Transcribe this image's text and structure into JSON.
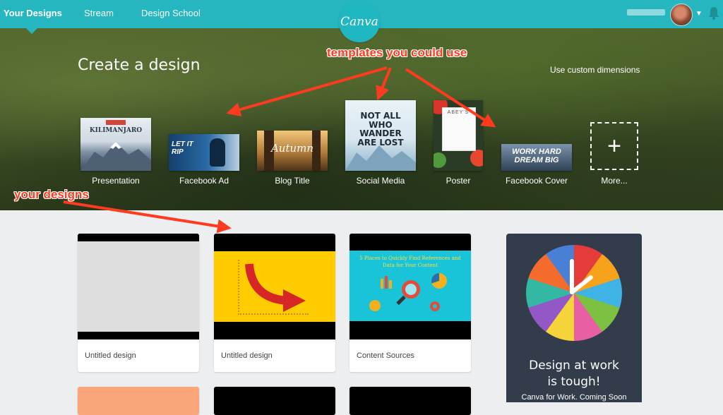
{
  "nav": {
    "items": [
      {
        "label": "Your Designs",
        "active": true
      },
      {
        "label": "Stream",
        "active": false
      },
      {
        "label": "Design School",
        "active": false
      }
    ],
    "logo_text": "Canva",
    "accent_color": "#25b6bf"
  },
  "hero": {
    "title": "Create a design",
    "custom_dimensions": "Use custom dimensions",
    "templates": [
      {
        "label": "Presentation",
        "thumb_text": "KILIMANJARO"
      },
      {
        "label": "Facebook Ad",
        "thumb_text": "LET IT RIP"
      },
      {
        "label": "Blog Title",
        "thumb_text": "Autumn"
      },
      {
        "label": "Social Media",
        "thumb_text": "NOT ALL WHO WANDER ARE LOST"
      },
      {
        "label": "Poster",
        "thumb_text": "ABEY'S"
      },
      {
        "label": "Facebook Cover",
        "thumb_text": "WORK HARD DREAM BIG"
      },
      {
        "label": "More...",
        "thumb_text": "+"
      }
    ]
  },
  "annotations": {
    "templates": "templates you could use",
    "designs": "your designs",
    "color": "#ff3b1f"
  },
  "designs": [
    {
      "label": "Untitled design"
    },
    {
      "label": "Untitled design"
    },
    {
      "label": "Content Sources",
      "thumb_text": "5 Places to Quickly Find References and Data for Your Content"
    }
  ],
  "promo": {
    "title_line1": "Design at work",
    "title_line2": "is tough!",
    "subtitle": "Canva for Work. Coming Soon"
  }
}
